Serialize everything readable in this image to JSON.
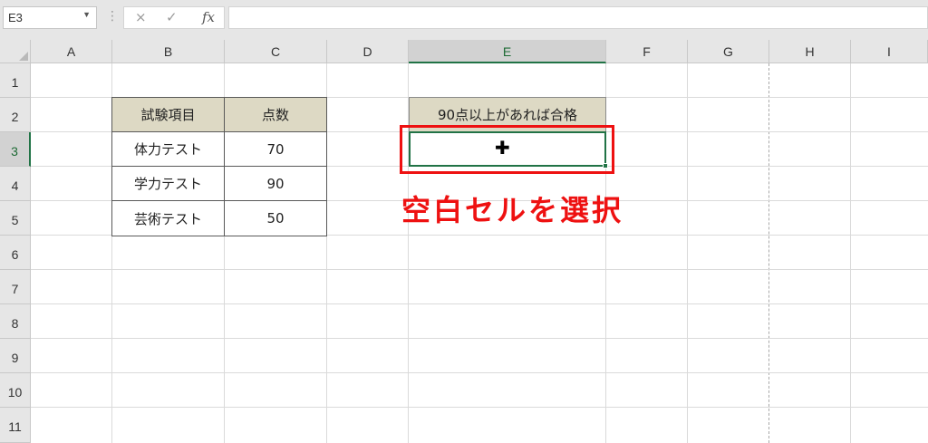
{
  "formula_bar": {
    "name_box": "E3",
    "cancel_icon": "×",
    "enter_icon": "✓",
    "function_label": "fx",
    "formula": ""
  },
  "columns": [
    "A",
    "B",
    "C",
    "D",
    "E",
    "F",
    "G",
    "H",
    "I"
  ],
  "rows": [
    "1",
    "2",
    "3",
    "4",
    "5",
    "6",
    "7",
    "8",
    "9",
    "10",
    "11"
  ],
  "selected_cell": "E3",
  "table": {
    "headers": [
      "試験項目",
      "点数"
    ],
    "rows": [
      [
        "体力テスト",
        "70"
      ],
      [
        "学力テスト",
        "90"
      ],
      [
        "芸術テスト",
        "50"
      ]
    ]
  },
  "criteria_header": "90点以上があれば合格",
  "criteria_value": "",
  "annotation": "空白セルを選択",
  "colors": {
    "header_fill": "#ddd9c4",
    "selection": "#217346",
    "annotation_red": "#ee1111"
  },
  "icons": {
    "cursor": "cell-select-cross-icon",
    "name_box_dropdown": "chevron-down-icon"
  }
}
